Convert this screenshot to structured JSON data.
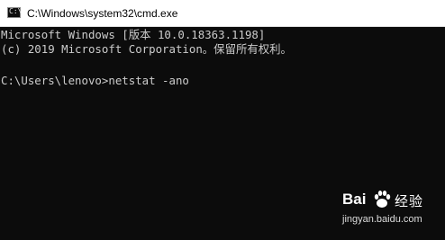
{
  "window": {
    "title": "C:\\Windows\\system32\\cmd.exe",
    "icon": "cmd-icon"
  },
  "console": {
    "lines": [
      "Microsoft Windows [版本 10.0.18363.1198]",
      "(c) 2019 Microsoft Corporation。保留所有权利。",
      "",
      "C:\\Users\\lenovo>netstat -ano"
    ]
  },
  "watermark": {
    "brand": "Bai",
    "brand_cn": "经验",
    "url": "jingyan.baidu.com",
    "icon": "baidu-paw-icon"
  },
  "colors": {
    "console_bg": "#0c0c0c",
    "console_text": "#cccccc",
    "titlebar_bg": "#ffffff"
  }
}
